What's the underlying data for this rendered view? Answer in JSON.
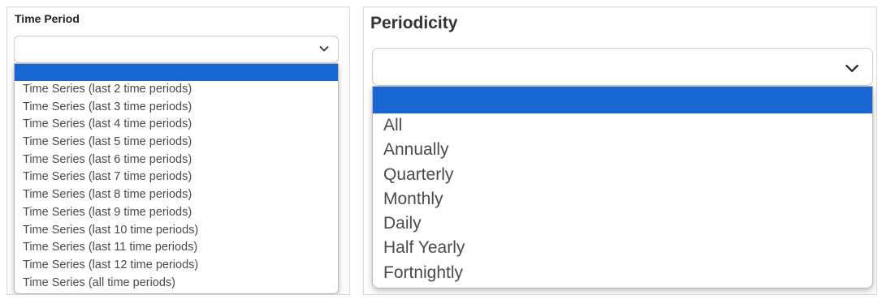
{
  "time_period": {
    "label": "Time Period",
    "selected": "",
    "options": [
      "",
      "Time Series (last 2 time periods)",
      "Time Series (last 3 time periods)",
      "Time Series (last 4 time periods)",
      "Time Series (last 5 time periods)",
      "Time Series (last 6 time periods)",
      "Time Series (last 7 time periods)",
      "Time Series (last 8 time periods)",
      "Time Series (last 9 time periods)",
      "Time Series (last 10 time periods)",
      "Time Series (last 11 time periods)",
      "Time Series (last 12 time periods)",
      "Time Series (all time periods)"
    ]
  },
  "periodicity": {
    "label": "Periodicity",
    "selected": "",
    "options": [
      "",
      "All",
      "Annually",
      "Quarterly",
      "Monthly",
      "Daily",
      "Half Yearly",
      "Fortnightly"
    ]
  },
  "colors": {
    "highlight": "#1a66d2",
    "option_text": "#4a4a4a",
    "label_text": "#222222"
  },
  "icons": {
    "dropdown_arrow": "chevron-down-icon"
  }
}
